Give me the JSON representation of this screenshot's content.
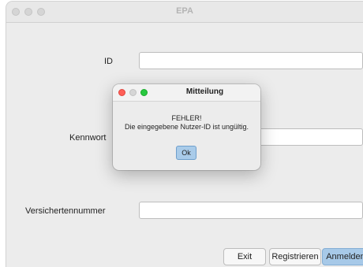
{
  "window": {
    "title": "EPA",
    "traffic_lights": [
      "close-icon",
      "minimize-icon",
      "zoom-icon"
    ]
  },
  "form": {
    "id_label": "ID",
    "id_value": "",
    "password_label": "Kennwort",
    "password_value": "",
    "insurance_label": "Versichertennummer",
    "insurance_value": ""
  },
  "buttons": {
    "exit": "Exit",
    "register": "Registrieren",
    "login": "Anmelden"
  },
  "dialog": {
    "title": "Mitteilung",
    "error_title": "FEHLER!",
    "message": "Die eingegebene Nutzer-ID ist ungültig.",
    "ok": "Ok",
    "colors": {
      "close": "#fe5f57",
      "minimize": "#d6d6d6",
      "zoom": "#28c840"
    }
  }
}
